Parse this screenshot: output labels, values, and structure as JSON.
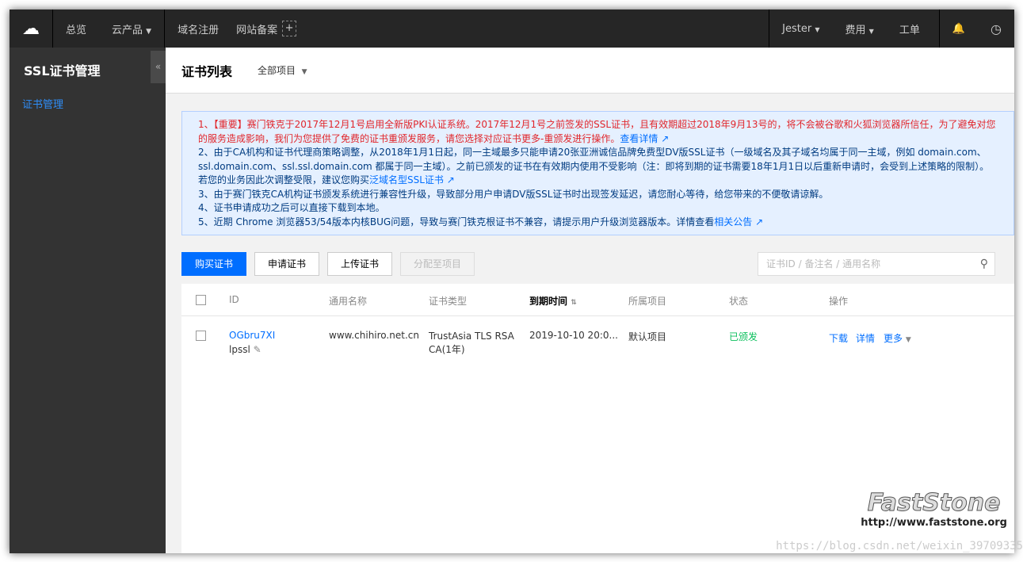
{
  "topbar": {
    "nav": [
      "总览",
      "云产品",
      "域名注册",
      "网站备案"
    ],
    "user": "Jester",
    "fee": "费用",
    "ticket": "工单"
  },
  "sidebar": {
    "title": "SSL证书管理",
    "items": [
      "证书管理"
    ],
    "collapse": "«"
  },
  "header": {
    "title": "证书列表",
    "project": "全部项目"
  },
  "notice": {
    "l1": "1、【重要】赛门铁克于2017年12月1号启用全新版PKI认证系统。2017年12月1号之前签发的SSL证书，且有效期超过2018年9月13号的，将不会被谷歌和火狐浏览器所信任，为了避免对您的服务造成影响，我们为您提供了免费的证书重颁发服务，请您选择对应证书更多-重颁发进行操作。",
    "l1_link": "查看详情",
    "l2": "2、由于CA机构和证书代理商策略调整，从2018年1月1日起，同一主域最多只能申请20张亚洲诚信品牌免费型DV版SSL证书（一级域名及其子域名均属于同一主域，例如 domain.com、ssl.domain.com、ssl.ssl.domain.com 都属于同一主域）。之前已颁发的证书在有效期内使用不受影响（注：即将到期的证书需要18年1月1日以后重新申请时，会受到上述策略的限制）。若您的业务因此次调整受限，建议您购买",
    "l2_link": "泛域名型SSL证书",
    "l3": "3、由于赛门铁克CA机构证书颁发系统进行兼容性升级，导致部分用户申请DV版SSL证书时出现签发延迟，请您耐心等待，给您带来的不便敬请谅解。",
    "l4": "4、证书申请成功之后可以直接下载到本地。",
    "l5": "5、近期 Chrome 浏览器53/54版本内核BUG问题，导致与赛门铁克根证书不兼容，请提示用户升级浏览器版本。详情查看",
    "l5_link": "相关公告"
  },
  "toolbar": {
    "buy": "购买证书",
    "apply": "申请证书",
    "upload": "上传证书",
    "assign": "分配至项目",
    "search_placeholder": "证书ID / 备注名 / 通用名称"
  },
  "table": {
    "columns": [
      "ID",
      "通用名称",
      "证书类型",
      "到期时间",
      "所属项目",
      "状态",
      "操作"
    ],
    "rows": [
      {
        "id": "OGbru7XI",
        "note": "lpssl",
        "cn": "www.chihiro.net.cn",
        "type1": "TrustAsia TLS RSA",
        "type2": "CA(1年)",
        "expiry": "2019-10-10 20:0...",
        "project": "默认项目",
        "status": "已颁发",
        "actions": [
          "下载",
          "详情",
          "更多"
        ]
      }
    ]
  },
  "status_color": "#0abf5b",
  "watermark": {
    "logo": "FastStone",
    "url": "http://www.faststone.org",
    "csdn": "https://blog.csdn.net/weixin_39709335"
  }
}
